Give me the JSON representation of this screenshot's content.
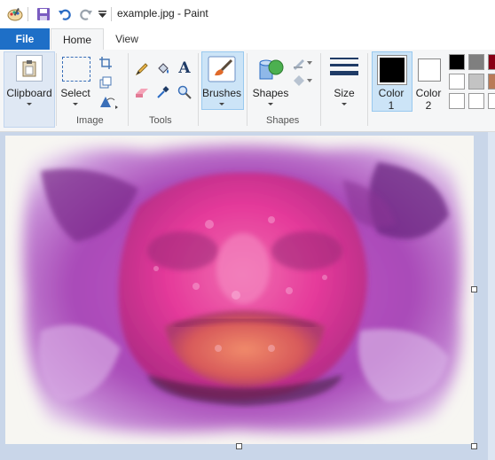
{
  "window": {
    "title": "example.jpg - Paint",
    "quick_access": [
      "paint-app-icon",
      "save-icon",
      "undo-icon",
      "redo-icon",
      "customize-quick-access-icon"
    ]
  },
  "tabs": [
    {
      "label": "File",
      "active": false
    },
    {
      "label": "Home",
      "active": true
    },
    {
      "label": "View",
      "active": false
    }
  ],
  "ribbon": {
    "clipboard": {
      "label": "Clipboard"
    },
    "image": {
      "group_label": "Image",
      "select_label": "Select"
    },
    "tools": {
      "group_label": "Tools"
    },
    "brushes": {
      "label": "Brushes"
    },
    "shapes": {
      "group_label": "Shapes",
      "button_label": "Shapes"
    },
    "size": {
      "label": "Size"
    },
    "color1": {
      "label_line1": "Color",
      "label_line2": "1",
      "value": "#000000"
    },
    "color2": {
      "label_line1": "Color",
      "label_line2": "2",
      "value": "#ffffff"
    },
    "palette": [
      "#000000",
      "#7f7f7f",
      "#880015",
      "#ffffff",
      "#c3c3c3",
      "#b97a57",
      "#ffffff",
      "#ffffff",
      "#ffffff"
    ]
  },
  "colors": {
    "accent": "#1e6fc7",
    "selected_bg": "#cce4f7",
    "workspace_bg": "#c9d6e9"
  },
  "canvas": {
    "content": "watercolor-style image of a pink scorpionfish face"
  }
}
